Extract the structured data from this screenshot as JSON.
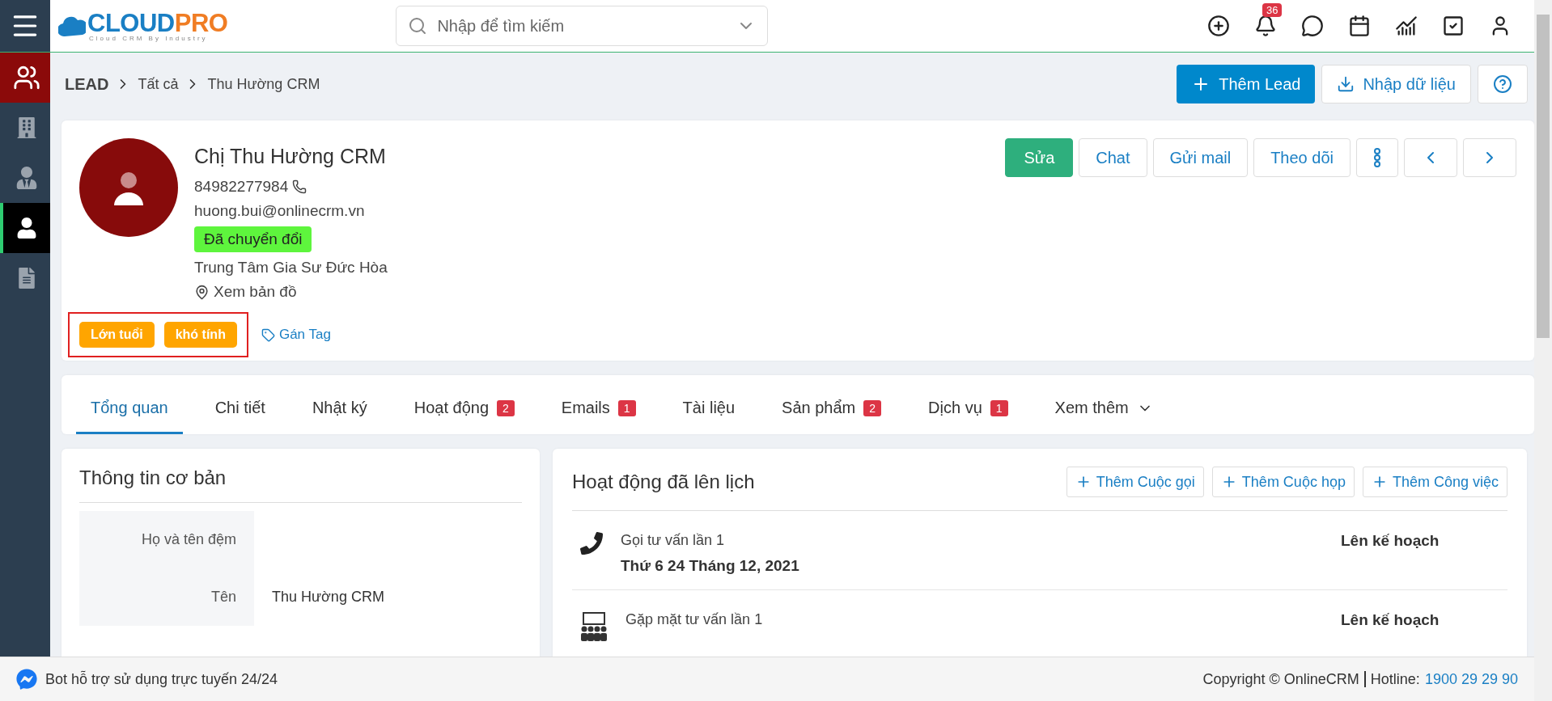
{
  "topbar": {
    "logo_primary": "CLOUD",
    "logo_accent": "PRO",
    "tagline": "Cloud CRM By Industry",
    "search": {
      "placeholder": "Nhập để tìm kiếm"
    },
    "notification_count": "36"
  },
  "sidebar": {
    "items": [
      {
        "kind": "module",
        "selected": false
      },
      {
        "kind": "nav",
        "selected": false
      },
      {
        "kind": "nav",
        "selected": false
      },
      {
        "kind": "nav",
        "selected": true
      },
      {
        "kind": "nav",
        "selected": false
      }
    ]
  },
  "breadcrumb": [
    "LEAD",
    "Tất cả",
    "Thu Hường CRM"
  ],
  "header_actions": {
    "add": "Thêm Lead",
    "import": "Nhập dữ liệu"
  },
  "profile": {
    "name": "Chị Thu Hường CRM",
    "phone": "84982277984",
    "email": "huong.bui@onlinecrm.vn",
    "status": "Đã chuyển đổi",
    "company": "Trung Tâm Gia Sư Đức Hòa",
    "map_link": "Xem bản đồ",
    "tags": [
      "Lớn tuổi",
      "khó tính"
    ],
    "tags_highlighted": true,
    "add_tag": "Gán Tag",
    "actions": [
      {
        "kind": "primary",
        "label": "Sửa"
      },
      {
        "kind": "outline",
        "label": "Chat"
      },
      {
        "kind": "outline",
        "label": "Gửi mail"
      },
      {
        "kind": "outline",
        "label": "Theo dõi"
      },
      {
        "kind": "more"
      },
      {
        "kind": "prev"
      },
      {
        "kind": "next"
      }
    ]
  },
  "tabs": [
    {
      "label": "Tổng quan",
      "selected": true
    },
    {
      "label": "Chi tiết",
      "selected": false
    },
    {
      "label": "Nhật ký",
      "selected": false
    },
    {
      "label": "Hoạt động",
      "count": "2",
      "selected": false
    },
    {
      "label": "Emails",
      "count": "1",
      "selected": false
    },
    {
      "label": "Tài liệu",
      "selected": false
    },
    {
      "label": "Sản phẩm",
      "count": "2",
      "selected": false
    },
    {
      "label": "Dịch vụ",
      "count": "1",
      "selected": false
    },
    {
      "label": "Xem thêm",
      "kind": "dropdown",
      "selected": false
    }
  ],
  "basic_info": {
    "title": "Thông tin cơ bản",
    "fields": [
      {
        "label": "Họ và tên đệm"
      },
      {
        "label": "Tên",
        "value": "Thu Hường CRM"
      }
    ]
  },
  "scheduled": {
    "title": "Hoạt động đã lên lịch",
    "buttons": [
      "Thêm Cuộc gọi",
      "Thêm Cuộc họp",
      "Thêm Công việc"
    ],
    "activities": [
      {
        "kind": "call",
        "title": "Gọi tư vấn lần 1",
        "date": "Thứ 6 24 Tháng 12, 2021",
        "status": "Lên kế hoạch"
      },
      {
        "kind": "meeting",
        "title": "Gặp mặt tư vấn lần 1",
        "status": "Lên kế hoạch"
      }
    ]
  },
  "footer": {
    "bot": "Bot hỗ trợ sử dụng trực tuyến 24/24",
    "copyright": "Copyright © OnlineCRM",
    "hotline_label": "Hotline:",
    "hotline": "1900 29 29 90"
  }
}
